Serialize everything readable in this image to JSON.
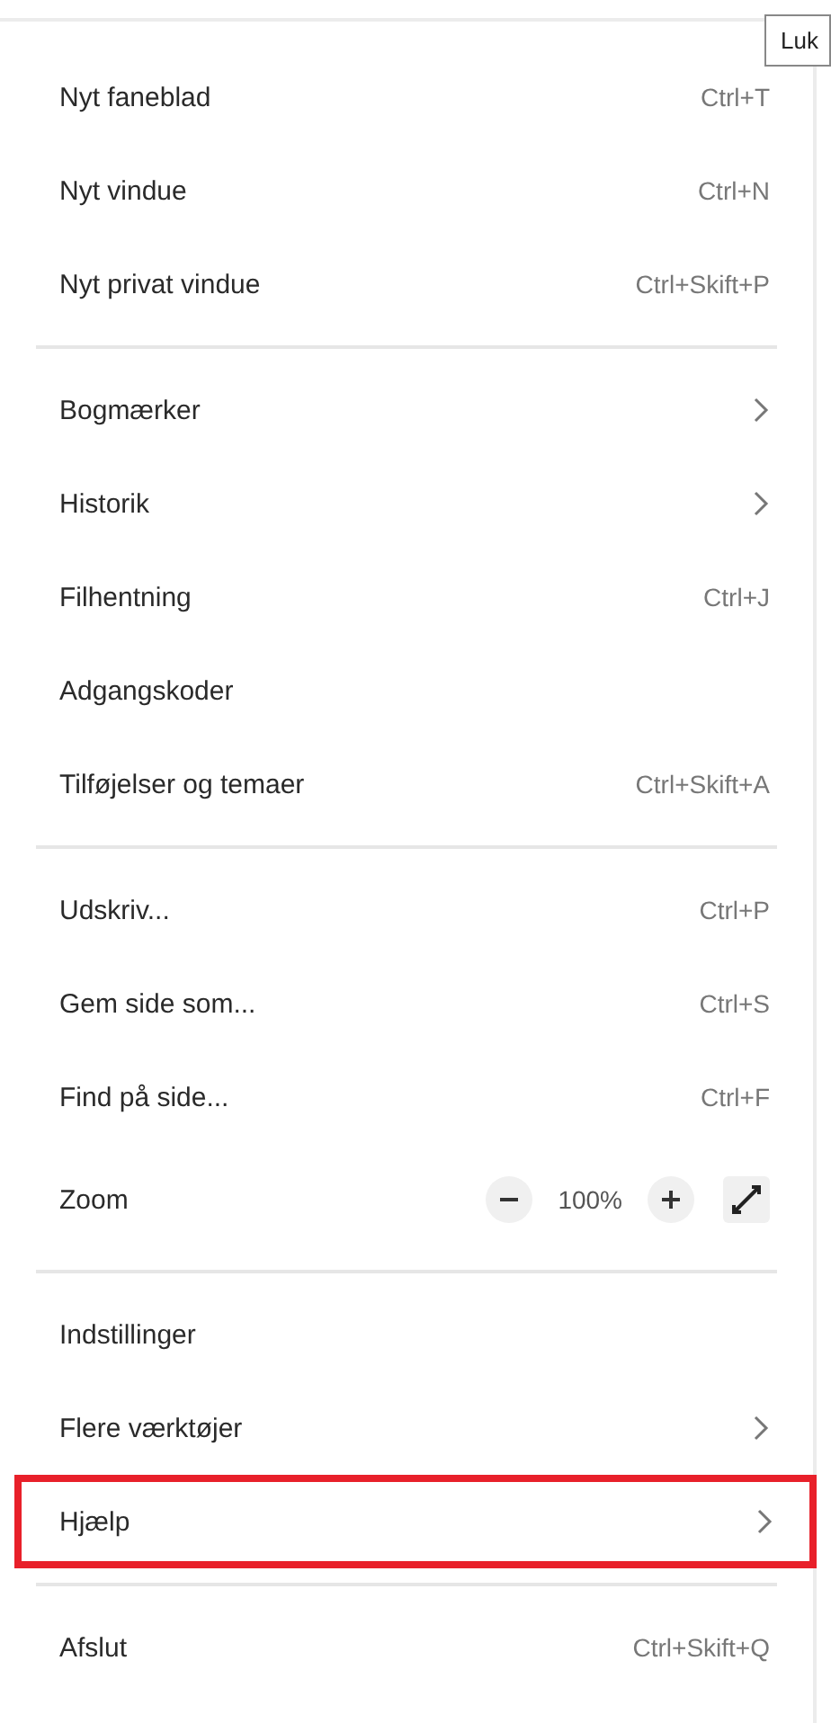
{
  "tooltip": {
    "text": "Luk"
  },
  "sections": [
    {
      "items": [
        {
          "kind": "shortcut",
          "label": "Nyt faneblad",
          "shortcut": "Ctrl+T",
          "highlighted": false
        },
        {
          "kind": "shortcut",
          "label": "Nyt vindue",
          "shortcut": "Ctrl+N",
          "highlighted": false
        },
        {
          "kind": "shortcut",
          "label": "Nyt privat vindue",
          "shortcut": "Ctrl+Skift+P",
          "highlighted": false
        }
      ]
    },
    {
      "items": [
        {
          "kind": "submenu",
          "label": "Bogmærker",
          "highlighted": false
        },
        {
          "kind": "submenu",
          "label": "Historik",
          "highlighted": false
        },
        {
          "kind": "shortcut",
          "label": "Filhentning",
          "shortcut": "Ctrl+J",
          "highlighted": false
        },
        {
          "kind": "plain",
          "label": "Adgangskoder",
          "highlighted": false
        },
        {
          "kind": "shortcut",
          "label": "Tilføjelser og temaer",
          "shortcut": "Ctrl+Skift+A",
          "highlighted": false
        }
      ]
    },
    {
      "items": [
        {
          "kind": "shortcut",
          "label": "Udskriv...",
          "shortcut": "Ctrl+P",
          "highlighted": false
        },
        {
          "kind": "shortcut",
          "label": "Gem side som...",
          "shortcut": "Ctrl+S",
          "highlighted": false
        },
        {
          "kind": "shortcut",
          "label": "Find på side...",
          "shortcut": "Ctrl+F",
          "highlighted": false
        },
        {
          "kind": "zoom",
          "label": "Zoom",
          "value": "100%",
          "highlighted": false
        }
      ]
    },
    {
      "items": [
        {
          "kind": "plain",
          "label": "Indstillinger",
          "highlighted": false
        },
        {
          "kind": "submenu",
          "label": "Flere værktøjer",
          "highlighted": false
        },
        {
          "kind": "submenu",
          "label": "Hjælp",
          "highlighted": true
        }
      ]
    },
    {
      "items": [
        {
          "kind": "shortcut",
          "label": "Afslut",
          "shortcut": "Ctrl+Skift+Q",
          "highlighted": false
        }
      ]
    }
  ]
}
